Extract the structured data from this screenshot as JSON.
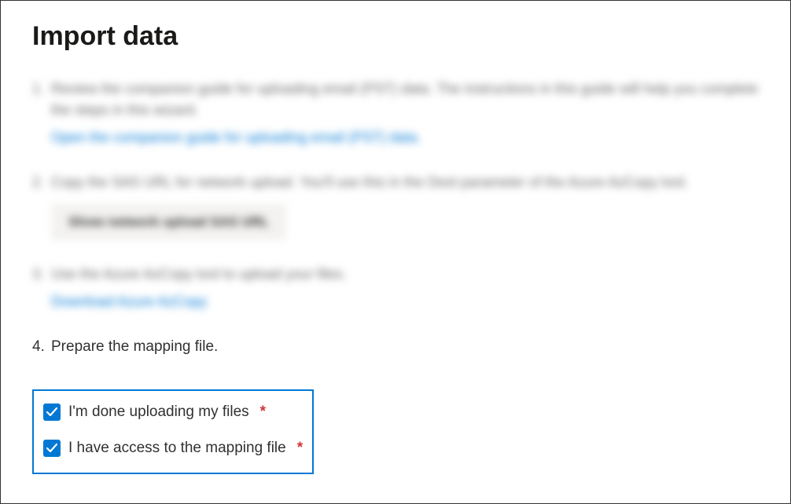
{
  "header": {
    "title": "Import data"
  },
  "steps": {
    "s1": {
      "text": "Review the companion guide for uploading email (PST) data. The instructions in this guide will help you complete the steps in this wizard.",
      "link": "Open the companion guide for uploading email (PST) data."
    },
    "s2": {
      "text": "Copy the SAS URL for network upload. You'll use this in the Dest parameter of the Azure AzCopy tool.",
      "button": "Show network upload SAS URL"
    },
    "s3": {
      "text": "Use the Azure AzCopy tool to upload your files.",
      "link": "Download Azure AzCopy"
    },
    "s4": {
      "text": "Prepare the mapping file."
    }
  },
  "checkboxes": {
    "c1": {
      "label": "I'm done uploading my files",
      "required": "*",
      "checked": true
    },
    "c2": {
      "label": "I have access to the mapping file",
      "required": "*",
      "checked": true
    }
  }
}
